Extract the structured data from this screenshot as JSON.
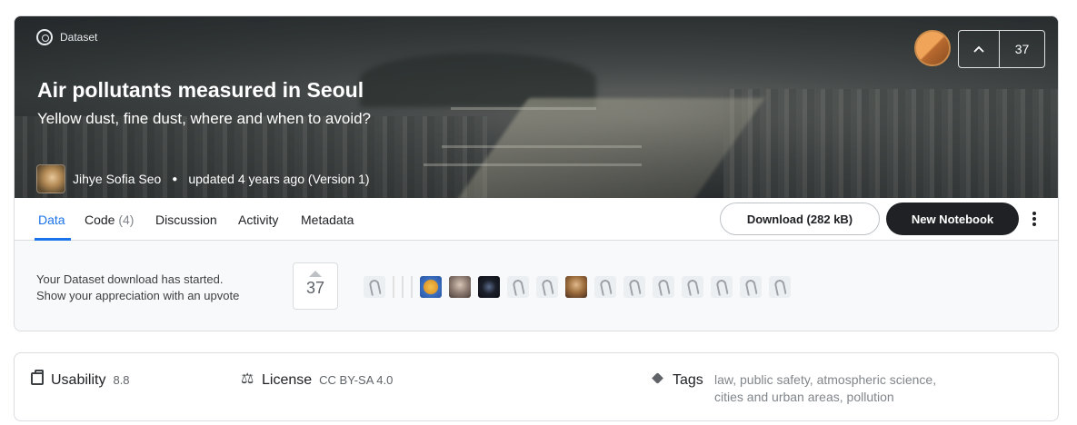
{
  "header": {
    "type_label": "Dataset",
    "title": "Air pollutants measured in Seoul",
    "subtitle": "Yellow dust, fine dust, where and when to avoid?",
    "author": "Jihye Sofia Seo",
    "updated": "updated 4 years ago (Version 1)",
    "upvotes": "37"
  },
  "tabs": [
    {
      "label": "Data"
    },
    {
      "label": "Code",
      "count": "(4)"
    },
    {
      "label": "Discussion"
    },
    {
      "label": "Activity"
    },
    {
      "label": "Metadata"
    }
  ],
  "actions": {
    "download_label": "Download (282 kB)",
    "new_notebook_label": "New Notebook"
  },
  "notice": {
    "line1": "Your Dataset download has started.",
    "line2": "Show your appreciation with an upvote",
    "upvotes": "37"
  },
  "info": {
    "usability_label": "Usability",
    "usability_value": "8.8",
    "license_label": "License",
    "license_value": "CC BY-SA 4.0",
    "tags_label": "Tags",
    "tags": [
      "law",
      "public safety",
      "atmospheric science",
      "cities and urban areas",
      "pollution"
    ]
  },
  "icons": [
    "dataset-icon",
    "upvote-arrow-icon",
    "more-vert-icon",
    "usability-icon",
    "license-icon",
    "tag-icon"
  ]
}
